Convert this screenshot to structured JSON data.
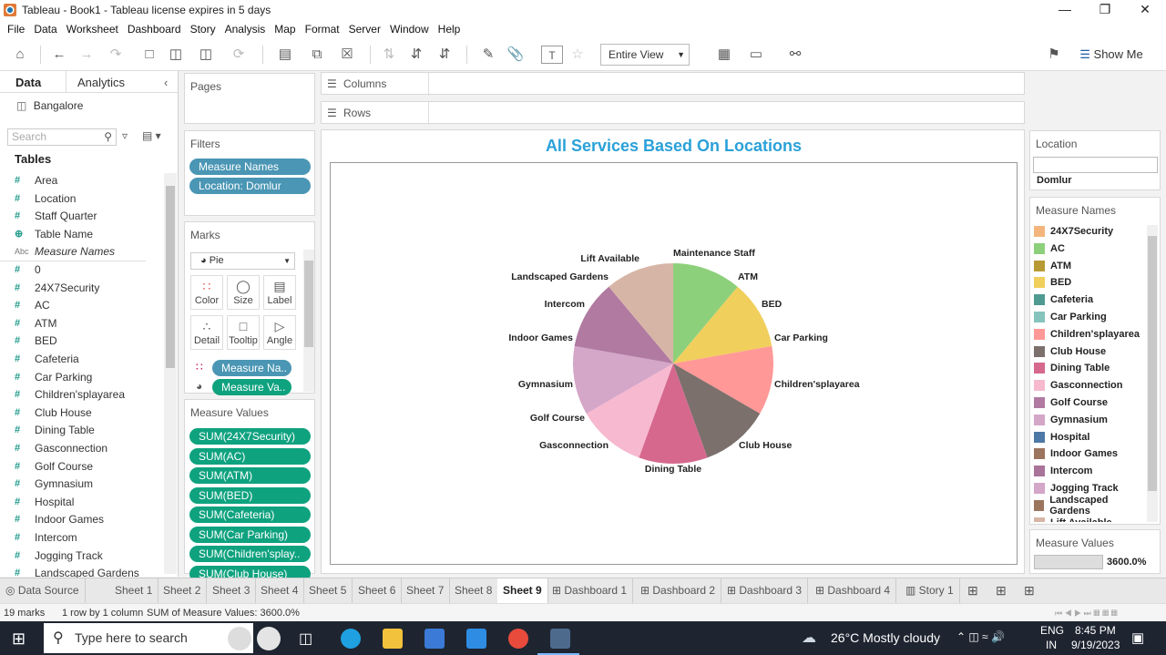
{
  "window": {
    "title": "Tableau - Book1 - Tableau license expires in 5 days"
  },
  "menu": [
    "File",
    "Data",
    "Worksheet",
    "Dashboard",
    "Story",
    "Analysis",
    "Map",
    "Format",
    "Server",
    "Window",
    "Help"
  ],
  "toolbar": {
    "fit_value": "Entire View",
    "show_me": "Show Me"
  },
  "data_pane": {
    "tab_data": "Data",
    "tab_analytics": "Analytics",
    "datasource": "Bangalore",
    "search_placeholder": "Search",
    "tables_header": "Tables",
    "fields": [
      {
        "name": "Area",
        "type": "#"
      },
      {
        "name": "Location",
        "type": "#"
      },
      {
        "name": "Staff Quarter",
        "type": "#"
      },
      {
        "name": "Table Name",
        "type": "globe"
      },
      {
        "name": "Measure Names",
        "type": "Abc"
      },
      {
        "name": "0",
        "type": "#"
      },
      {
        "name": "24X7Security",
        "type": "#"
      },
      {
        "name": "AC",
        "type": "#"
      },
      {
        "name": "ATM",
        "type": "#"
      },
      {
        "name": "BED",
        "type": "#"
      },
      {
        "name": "Cafeteria",
        "type": "#"
      },
      {
        "name": "Car Parking",
        "type": "#"
      },
      {
        "name": "Children'splayarea",
        "type": "#"
      },
      {
        "name": "Club House",
        "type": "#"
      },
      {
        "name": "Dining Table",
        "type": "#"
      },
      {
        "name": "Gasconnection",
        "type": "#"
      },
      {
        "name": "Golf Course",
        "type": "#"
      },
      {
        "name": "Gymnasium",
        "type": "#"
      },
      {
        "name": "Hospital",
        "type": "#"
      },
      {
        "name": "Indoor Games",
        "type": "#"
      },
      {
        "name": "Intercom",
        "type": "#"
      },
      {
        "name": "Jogging Track",
        "type": "#"
      },
      {
        "name": "Landscaped Gardens",
        "type": "#"
      }
    ]
  },
  "shelves": {
    "pages": "Pages",
    "filters": "Filters",
    "filter_pills": [
      "Measure Names",
      "Location: Domlur"
    ],
    "marks": "Marks",
    "mark_type": "Pie",
    "mark_buttons": [
      "Color",
      "Size",
      "Label",
      "Detail",
      "Tooltip",
      "Angle"
    ],
    "mark_pills": [
      "Measure Na..",
      "Measure Va.."
    ],
    "measure_values": "Measure Values",
    "measure_pills": [
      "SUM(24X7Security)",
      "SUM(AC)",
      "SUM(ATM)",
      "SUM(BED)",
      "SUM(Cafeteria)",
      "SUM(Car Parking)",
      "SUM(Children'splay..",
      "SUM(Club House)"
    ],
    "columns": "Columns",
    "rows": "Rows"
  },
  "legend": {
    "location_title": "Location",
    "location_value": "Domlur",
    "measure_names_title": "Measure Names",
    "items": [
      {
        "name": "24X7Security",
        "color": "#f4b57c"
      },
      {
        "name": "AC",
        "color": "#8dd07b"
      },
      {
        "name": "ATM",
        "color": "#b89a35"
      },
      {
        "name": "BED",
        "color": "#f0cf5c"
      },
      {
        "name": "Cafeteria",
        "color": "#4f9a91"
      },
      {
        "name": "Car Parking",
        "color": "#86c3bd"
      },
      {
        "name": "Children'splayarea",
        "color": "#ff9896"
      },
      {
        "name": "Club House",
        "color": "#7b706c"
      },
      {
        "name": "Dining Table",
        "color": "#d6688e"
      },
      {
        "name": "Gasconnection",
        "color": "#f7b9cf"
      },
      {
        "name": "Golf Course",
        "color": "#b07aa1"
      },
      {
        "name": "Gymnasium",
        "color": "#d4a6c8"
      },
      {
        "name": "Hospital",
        "color": "#4e79a7"
      },
      {
        "name": "Indoor Games",
        "color": "#9c755f"
      },
      {
        "name": "Intercom",
        "color": "#a9739a"
      },
      {
        "name": "Jogging Track",
        "color": "#d4a6c8"
      },
      {
        "name": "Landscaped Gardens",
        "color": "#9c755f"
      },
      {
        "name": "Lift Available",
        "color": "#d7b5a6"
      }
    ],
    "measure_values_title": "Measure Values",
    "measure_values_value": "3600.0%"
  },
  "chart_data": {
    "type": "pie",
    "title": "All Services Based On Locations",
    "slices": [
      {
        "label": "Maintenance Staff",
        "value": 1,
        "color": "#8dd07b"
      },
      {
        "label": "BED",
        "value": 1,
        "color": "#f0cf5c"
      },
      {
        "label": "Children'splayarea",
        "value": 1,
        "color": "#ff9896"
      },
      {
        "label": "Club House",
        "value": 1,
        "color": "#7b706c"
      },
      {
        "label": "Dining Table",
        "value": 1,
        "color": "#d6688e"
      },
      {
        "label": "Gasconnection",
        "value": 1,
        "color": "#f7b9cf"
      },
      {
        "label": "Gymnasium",
        "value": 1,
        "color": "#d4a6c8"
      },
      {
        "label": "Intercom",
        "value": 1,
        "color": "#b07aa1"
      },
      {
        "label": "Lift Available",
        "value": 1,
        "color": "#d7b5a6"
      }
    ],
    "outer_labels": [
      "Maintenance Staff",
      "ATM",
      "BED",
      "Car Parking",
      "Children'splayarea",
      "Club House",
      "Dining Table",
      "Gasconnection",
      "Golf Course",
      "Gymnasium",
      "Indoor Games",
      "Intercom",
      "Landscaped Gardens",
      "Lift Available"
    ]
  },
  "sheet_tabs": [
    "Data Source",
    "Sheet 1",
    "Sheet 2",
    "Sheet 3",
    "Sheet 4",
    "Sheet 5",
    "Sheet 6",
    "Sheet 7",
    "Sheet 8",
    "Sheet 9",
    "Dashboard 1",
    "Dashboard 2",
    "Dashboard 3",
    "Dashboard 4",
    "Story 1"
  ],
  "active_sheet": "Sheet 9",
  "status": {
    "marks": "19 marks",
    "dims": "1 row by 1 column",
    "sum": "SUM of Measure Values: 3600.0%"
  },
  "taskbar": {
    "search_placeholder": "Type here to search",
    "weather": "26°C  Mostly cloudy",
    "lang1": "ENG",
    "lang2": "IN",
    "time": "8:45 PM",
    "date": "9/19/2023"
  }
}
